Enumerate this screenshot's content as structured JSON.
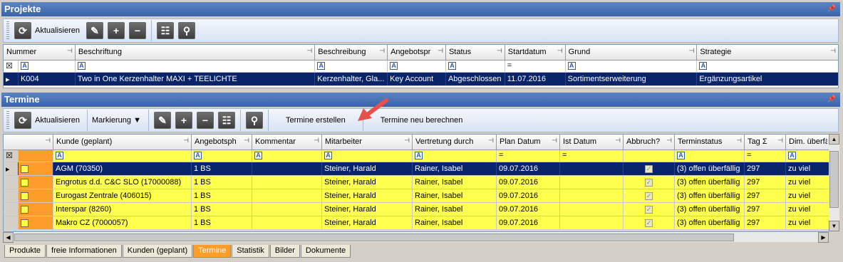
{
  "projekte": {
    "title": "Projekte",
    "toolbar": {
      "refresh_label": "Aktualisieren"
    },
    "columns": [
      "Nummer",
      "Beschriftung",
      "Beschreibung",
      "Angebotspr",
      "Status",
      "Startdatum",
      "Grund",
      "Strategie"
    ],
    "row": {
      "nummer": "K004",
      "beschriftung": "Two in One Kerzenhalter MAXI + TEELICHTE",
      "beschreibung": "Kerzenhalter,  Gla...",
      "angebotspr": "Key Account",
      "status": "Abgeschlossen",
      "startdatum": "11.07.2016",
      "grund": "Sortimentserweiterung",
      "strategie": "Ergänzungsartikel"
    }
  },
  "termine": {
    "title": "Termine",
    "toolbar": {
      "refresh_label": "Aktualisieren",
      "markierung_label": "Markierung",
      "create_label": "Termine erstellen",
      "recalc_label": "Termine neu berechnen"
    },
    "columns": [
      "Kunde (geplant)",
      "Angebotsph",
      "Kommentar",
      "Mitarbeiter",
      "Vertretung durch",
      "Plan Datum",
      "Ist Datum",
      "Abbruch?",
      "Terminstatus",
      "Tag",
      "Dim. überfä"
    ],
    "rows": [
      {
        "kunde": "AGM (70350)",
        "angebot": "1 BS",
        "kommentar": "",
        "mitarbeiter": "Steiner, Harald",
        "vertretung": "Rainer, Isabel",
        "plan": "09.07.2016",
        "ist": "",
        "status": "(3) offen überfällig",
        "tag": "297",
        "dim": "zu viel"
      },
      {
        "kunde": "Engrotus d.d. C&C SLO (17000088)",
        "angebot": "1 BS",
        "kommentar": "",
        "mitarbeiter": "Steiner, Harald",
        "vertretung": "Rainer, Isabel",
        "plan": "09.07.2016",
        "ist": "",
        "status": "(3) offen überfällig",
        "tag": "297",
        "dim": "zu viel"
      },
      {
        "kunde": "Eurogast Zentrale (406015)",
        "angebot": "1 BS",
        "kommentar": "",
        "mitarbeiter": "Steiner, Harald",
        "vertretung": "Rainer, Isabel",
        "plan": "09.07.2016",
        "ist": "",
        "status": "(3) offen überfällig",
        "tag": "297",
        "dim": "zu viel"
      },
      {
        "kunde": "Interspar (8260)",
        "angebot": "1 BS",
        "kommentar": "",
        "mitarbeiter": "Steiner, Harald",
        "vertretung": "Rainer, Isabel",
        "plan": "09.07.2016",
        "ist": "",
        "status": "(3) offen überfällig",
        "tag": "297",
        "dim": "zu viel"
      },
      {
        "kunde": "Makro CZ (7000057)",
        "angebot": "1 BS",
        "kommentar": "",
        "mitarbeiter": "Steiner, Harald",
        "vertretung": "Rainer, Isabel",
        "plan": "09.07.2016",
        "ist": "",
        "status": "(3) offen überfällig",
        "tag": "297",
        "dim": "zu viel"
      }
    ]
  },
  "tabs": [
    "Produkte",
    "freie Informationen",
    "Kunden (geplant)",
    "Termine",
    "Statistik",
    "Bilder",
    "Dokumente"
  ],
  "active_tab": "Termine",
  "filter_glyph": "A",
  "filter_eq": "=",
  "colors": {
    "header": "#3a64a8",
    "selected": "#0a246a",
    "highlight": "#ffff4d",
    "accent": "#ff9d2a",
    "arrow": "#e8504a"
  }
}
